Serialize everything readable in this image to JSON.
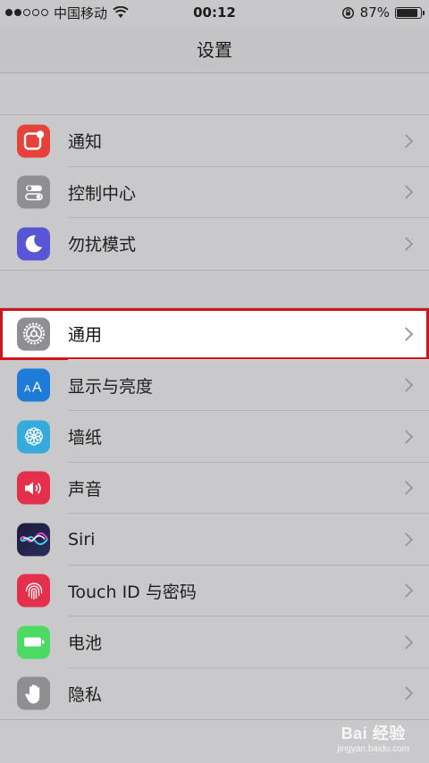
{
  "status_bar": {
    "carrier": "中国移动",
    "time": "00:12",
    "battery_percent_text": "87%",
    "battery_level": 0.87,
    "signal_bars_filled": 2,
    "signal_bars_total": 5
  },
  "nav": {
    "title": "设置"
  },
  "groups": [
    {
      "items": [
        {
          "label": "通知",
          "icon": "notifications-icon",
          "color": "#e4433b"
        },
        {
          "label": "控制中心",
          "icon": "control-center-icon",
          "color": "#8e8e93"
        },
        {
          "label": "勿扰模式",
          "icon": "moon-icon",
          "color": "#5856d6"
        }
      ]
    },
    {
      "items": [
        {
          "label": "通用",
          "icon": "gear-icon",
          "color": "#8e8e93",
          "highlighted": true
        },
        {
          "label": "显示与亮度",
          "icon": "display-brightness-icon",
          "color": "#1e7bd8"
        },
        {
          "label": "墙纸",
          "icon": "wallpaper-icon",
          "color": "#35aadc"
        },
        {
          "label": "声音",
          "icon": "speaker-icon",
          "color": "#e4304b"
        },
        {
          "label": "Siri",
          "icon": "siri-icon",
          "color": "#1b1b3a"
        },
        {
          "label": "Touch ID 与密码",
          "icon": "fingerprint-icon",
          "color": "#e4304b"
        },
        {
          "label": "电池",
          "icon": "battery-icon",
          "color": "#4cd964"
        },
        {
          "label": "隐私",
          "icon": "hand-icon",
          "color": "#8e8e93"
        }
      ]
    }
  ],
  "watermark": {
    "main": "Bai 经验",
    "sub": "jingyan.baidu.com"
  }
}
